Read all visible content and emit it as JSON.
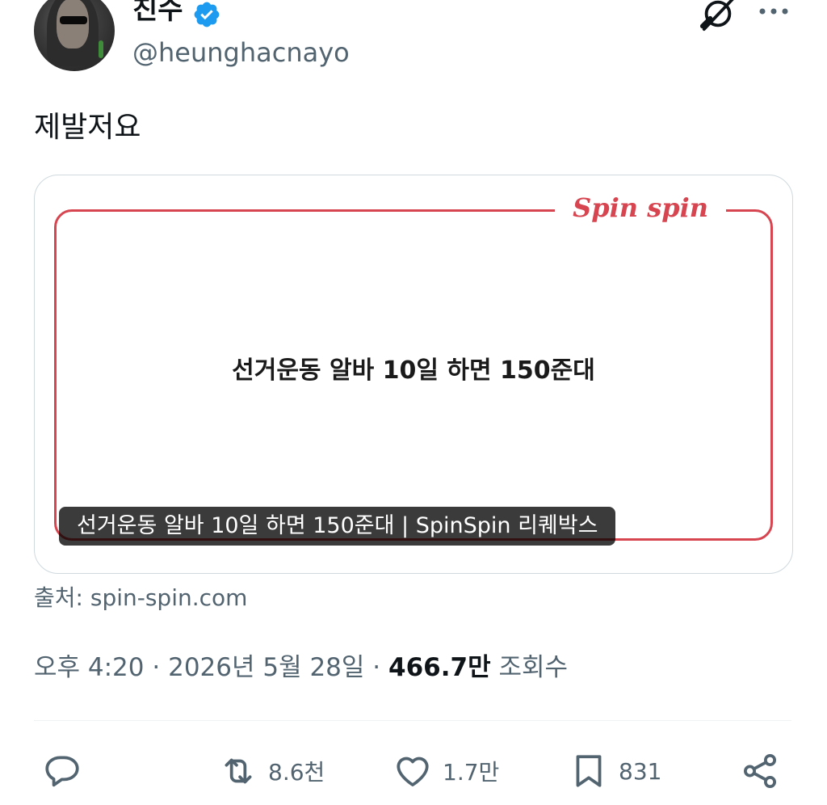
{
  "author": {
    "display_name": "친수",
    "handle": "@heunghacnayo",
    "verified_icon": "verified-badge-icon",
    "verified_color": "#1d9bf0"
  },
  "header": {
    "grok_icon": "grok-icon",
    "more_icon": "more-icon"
  },
  "tweet": {
    "text": "제발저요"
  },
  "card": {
    "brand": "Spin spin",
    "brand_color": "#d64550",
    "headline": "선거운동 알바 10일 하면 150준대",
    "caption": "선거운동 알바 10일 하면 150준대 | SpinSpin 리퀘박스",
    "source": "출처: spin-spin.com"
  },
  "meta": {
    "time": "오후 4:20",
    "separator": "·",
    "date": "2026년 5월 28일",
    "views_count": "466.7만",
    "views_label": "조회수"
  },
  "actions": {
    "reply": {
      "icon": "reply-icon",
      "count": ""
    },
    "retweet": {
      "icon": "retweet-icon",
      "count": "8.6천"
    },
    "like": {
      "icon": "heart-icon",
      "count": "1.7만"
    },
    "bookmark": {
      "icon": "bookmark-icon",
      "count": "831"
    },
    "share": {
      "icon": "share-icon",
      "count": ""
    }
  }
}
